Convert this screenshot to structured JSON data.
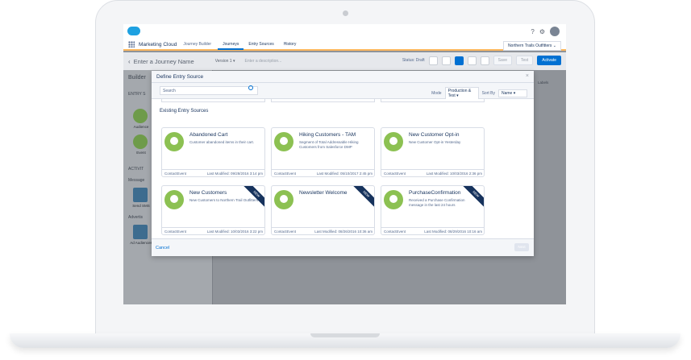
{
  "top_bar": {
    "help_icon": "?",
    "settings_icon": "⚙"
  },
  "nav": {
    "app_name": "Marketing Cloud",
    "breadcrumb": "Journey Builder",
    "tabs": [
      "Journeys",
      "Entry Sources",
      "History"
    ],
    "active_tab": "Journeys",
    "org_selector": "Northern Trails Outfitters"
  },
  "journey_header": {
    "name_placeholder": "Enter a Journey Name",
    "version": "Version 1",
    "description_placeholder": "Enter a description...",
    "status": "Status: Draft",
    "save": "Save",
    "test": "Test",
    "activate": "Activate"
  },
  "builder": {
    "title": "Builder",
    "sections": [
      "ENTRY S",
      "ACTIVIT",
      "Message",
      "Advertis"
    ],
    "items": [
      "Audience",
      "Event",
      "Send SMS",
      "Ad Audiences"
    ]
  },
  "right_panel": {
    "labels": "Labels"
  },
  "modal": {
    "title": "Define Entry Source",
    "search_placeholder": "Search",
    "mode_label": "Mode",
    "mode_value": "Production & Test",
    "sort_label": "Sort By",
    "sort_value": "Name",
    "section_title": "Existing Entry Sources",
    "cancel": "Cancel",
    "next": "Next",
    "cards": [
      {
        "title": "Abandoned Cart",
        "description": "Customer abandoned items in their cart.",
        "type": "ContactEvent",
        "modified": "Last Modified: 09/28/2016 3:14 pm",
        "is_new": false
      },
      {
        "title": "Hiking Customers - TAM",
        "description": "Segment of Total Addressable Hiking Customers from Salesforce DMP",
        "type": "ContactEvent",
        "modified": "Last Modified: 05/10/2017 2:45 pm",
        "is_new": false
      },
      {
        "title": "New Customer Opt-in",
        "description": "New Customer Opt-in Yesterday",
        "type": "ContactEvent",
        "modified": "Last Modified: 10/03/2016 2:36 pm",
        "is_new": false
      },
      {
        "title": "New Customers",
        "description": "New Customers to Northern Trail Outfitters",
        "type": "ContactEvent",
        "modified": "Last Modified: 10/03/2016 3:22 pm",
        "is_new": true
      },
      {
        "title": "Newsletter Welcome",
        "description": "",
        "type": "ContactEvent",
        "modified": "Last Modified: 08/26/2016 10:36 am",
        "is_new": true
      },
      {
        "title": "PurchaseConfirmation",
        "description": "Received a Purchase Confirmation message in the last 24 hours",
        "type": "ContactEvent",
        "modified": "Last Modified: 08/29/2016 10:16 am",
        "is_new": true
      }
    ],
    "new_badge": "NEW"
  }
}
